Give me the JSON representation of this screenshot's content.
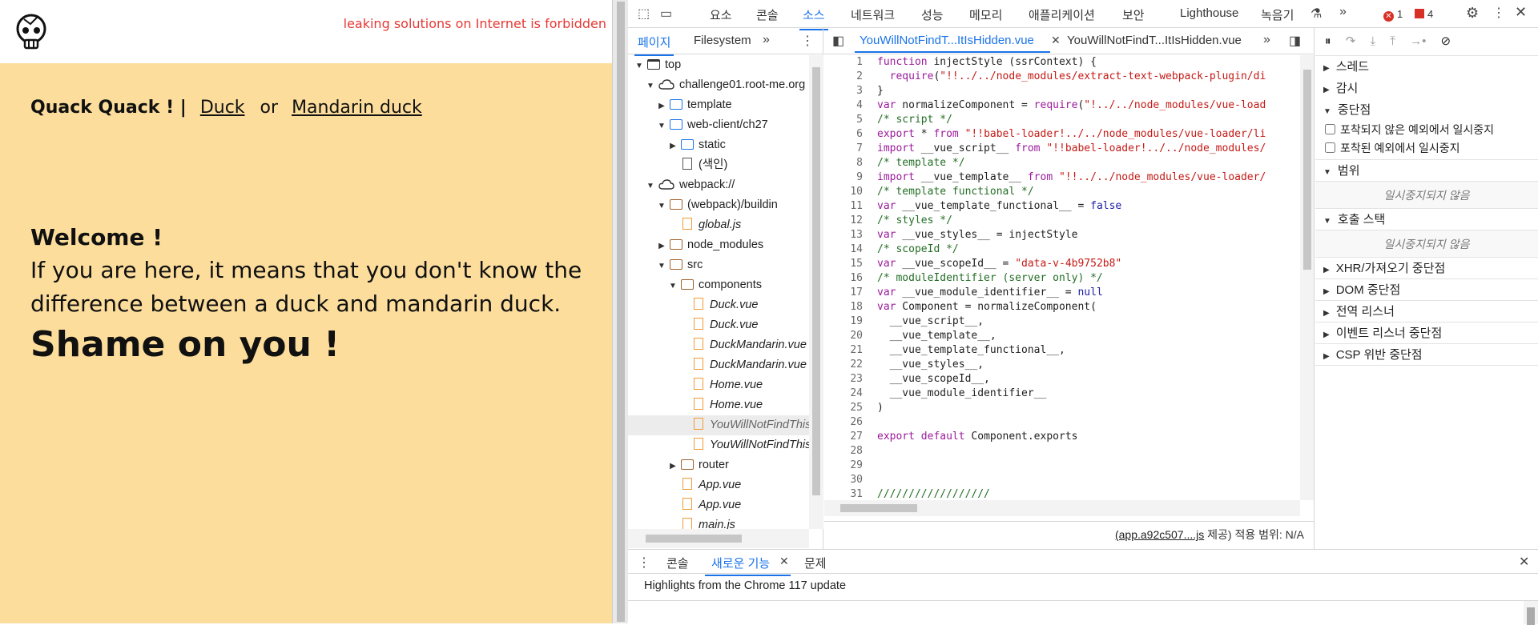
{
  "page": {
    "warning": "leaking solutions on Internet is forbidden",
    "nav": {
      "title": "Quack Quack ! |",
      "link1": "Duck",
      "or": "or",
      "link2": "Mandarin duck"
    },
    "welcome": {
      "heading": "Welcome !",
      "line1": "If you are here, it means that you don't know the",
      "line2": "difference between a duck and mandarin duck.",
      "shame": "Shame on you !"
    }
  },
  "devtools": {
    "top_tabs": [
      "요소",
      "콘솔",
      "소스",
      "네트워크",
      "성능",
      "메모리",
      "애플리케이션",
      "보안",
      "Lighthouse",
      "녹음기"
    ],
    "active_tab": "소스",
    "errors": "1",
    "warnings": "4",
    "navigator": {
      "tabs": [
        "페이지",
        "Filesystem"
      ],
      "tree": [
        {
          "label": "top",
          "indent": 0,
          "arrow": "▼",
          "icon": "top"
        },
        {
          "label": "challenge01.root-me.org",
          "indent": 1,
          "arrow": "▼",
          "icon": "cloud"
        },
        {
          "label": "template",
          "indent": 2,
          "arrow": "▶",
          "icon": "blue"
        },
        {
          "label": "web-client/ch27",
          "indent": 2,
          "arrow": "▼",
          "icon": "blue"
        },
        {
          "label": "static",
          "indent": 3,
          "arrow": "▶",
          "icon": "blue"
        },
        {
          "label": "(색인)",
          "indent": 3,
          "arrow": "",
          "icon": "doc"
        },
        {
          "label": "webpack://",
          "indent": 1,
          "arrow": "▼",
          "icon": "cloud"
        },
        {
          "label": "(webpack)/buildin",
          "indent": 2,
          "arrow": "▼",
          "icon": "brown"
        },
        {
          "label": "global.js",
          "indent": 3,
          "arrow": "",
          "icon": "file",
          "italic": true
        },
        {
          "label": "node_modules",
          "indent": 2,
          "arrow": "▶",
          "icon": "brown"
        },
        {
          "label": "src",
          "indent": 2,
          "arrow": "▼",
          "icon": "brown"
        },
        {
          "label": "components",
          "indent": 3,
          "arrow": "▼",
          "icon": "brown"
        },
        {
          "label": "Duck.vue",
          "indent": 4,
          "arrow": "",
          "icon": "file",
          "italic": true
        },
        {
          "label": "Duck.vue",
          "indent": 4,
          "arrow": "",
          "icon": "file",
          "italic": true
        },
        {
          "label": "DuckMandarin.vue",
          "indent": 4,
          "arrow": "",
          "icon": "file",
          "italic": true
        },
        {
          "label": "DuckMandarin.vue",
          "indent": 4,
          "arrow": "",
          "icon": "file",
          "italic": true
        },
        {
          "label": "Home.vue",
          "indent": 4,
          "arrow": "",
          "icon": "file",
          "italic": true
        },
        {
          "label": "Home.vue",
          "indent": 4,
          "arrow": "",
          "icon": "file",
          "italic": true
        },
        {
          "label": "YouWillNotFindThisRouteBecauseItIsHidden.vue",
          "indent": 4,
          "arrow": "",
          "icon": "file",
          "italic": true,
          "selected": true
        },
        {
          "label": "YouWillNotFindThisRouteBecauseItIsHidden.vue",
          "indent": 4,
          "arrow": "",
          "icon": "file",
          "italic": true
        },
        {
          "label": "router",
          "indent": 3,
          "arrow": "▶",
          "icon": "brown"
        },
        {
          "label": "App.vue",
          "indent": 3,
          "arrow": "",
          "icon": "file",
          "italic": true
        },
        {
          "label": "App.vue",
          "indent": 3,
          "arrow": "",
          "icon": "file",
          "italic": true
        },
        {
          "label": "main.js",
          "indent": 3,
          "arrow": "",
          "icon": "file",
          "italic": true
        }
      ]
    },
    "editor": {
      "tabs": [
        "YouWillNotFindT...ItIsHidden.vue",
        "YouWillNotFindT...ItIsHidden.vue"
      ],
      "lines": [
        "function injectStyle (ssrContext) {",
        "  require(\"!!../../node_modules/extract-text-webpack-plugin/di",
        "}",
        "var normalizeComponent = require(\"!../../node_modules/vue-load",
        "/* script */",
        "export * from \"!!babel-loader!../../node_modules/vue-loader/li",
        "import __vue_script__ from \"!!babel-loader!../../node_modules/",
        "/* template */",
        "import __vue_template__ from \"!!../../node_modules/vue-loader/",
        "/* template functional */",
        "var __vue_template_functional__ = false",
        "/* styles */",
        "var __vue_styles__ = injectStyle",
        "/* scopeId */",
        "var __vue_scopeId__ = \"data-v-4b9752b8\"",
        "/* moduleIdentifier (server only) */",
        "var __vue_module_identifier__ = null",
        "var Component = normalizeComponent(",
        "  __vue_script__,",
        "  __vue_template__,",
        "  __vue_template_functional__,",
        "  __vue_styles__,",
        "  __vue_scopeId__,",
        "  __vue_module_identifier__",
        ")",
        "",
        "export default Component.exports",
        "",
        "",
        "",
        "//////////////////"
      ],
      "status_link": "(app.a92c507....js",
      "status_rest": " 제공) 적용 범위: N/A"
    },
    "debugger": {
      "threads": "스레드",
      "watch": "감시",
      "breakpoints": "중단점",
      "pause_uncaught": "포착되지 않은 예외에서 일시중지",
      "pause_caught": "포착된 예외에서 일시중지",
      "scope": "범위",
      "scope_note": "일시중지되지 않음",
      "callstack": "호출 스택",
      "callstack_note": "일시중지되지 않음",
      "xhr": "XHR/가져오기 중단점",
      "dom": "DOM 중단점",
      "global": "전역 리스너",
      "event": "이벤트 리스너 중단점",
      "csp": "CSP 위반 중단점"
    },
    "drawer": {
      "tabs": [
        "콘솔",
        "새로운 기능",
        "문제"
      ],
      "highlights": "Highlights from the Chrome 117 update"
    }
  }
}
